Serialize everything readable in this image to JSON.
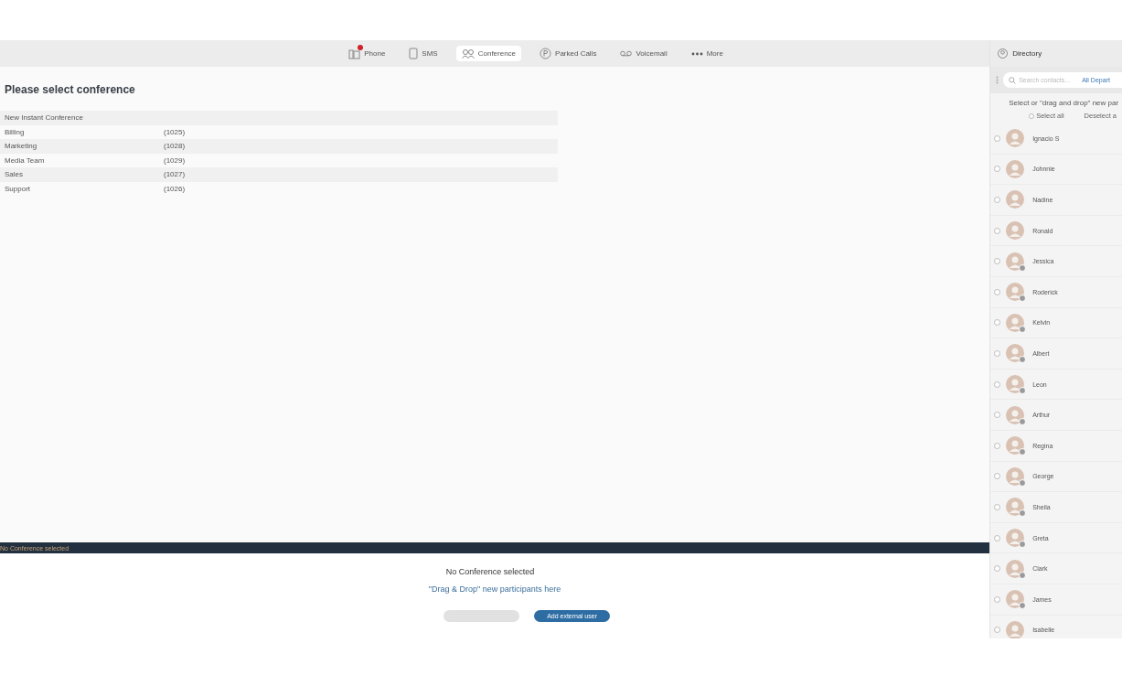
{
  "nav": {
    "tabs": [
      {
        "label": "Phone",
        "kind": "phone",
        "badge": true,
        "selected": false
      },
      {
        "label": "SMS",
        "kind": "sms",
        "badge": false,
        "selected": false
      },
      {
        "label": "Conference",
        "kind": "conference",
        "badge": false,
        "selected": true
      },
      {
        "label": "Parked Calls",
        "kind": "parked",
        "badge": false,
        "selected": false
      },
      {
        "label": "Voicemail",
        "kind": "voicemail",
        "badge": false,
        "selected": false
      },
      {
        "label": "More",
        "kind": "more",
        "badge": false,
        "selected": false
      }
    ]
  },
  "main": {
    "title": "Please select conference",
    "conferences": [
      {
        "name": "New Instant Conference"
      },
      {
        "name": "Billing",
        "number": "(1025)"
      },
      {
        "name": "Marketing",
        "number": "(1028)"
      },
      {
        "name": "Media Team",
        "number": "(1029)"
      },
      {
        "name": "Sales",
        "number": "(1027)"
      },
      {
        "name": "Support",
        "number": "(1026)"
      }
    ]
  },
  "status_bar": {
    "text": "No Conference selected"
  },
  "details": {
    "title": "No Conference selected",
    "hint": "\"Drag & Drop\" new participants here",
    "buttons": [
      {
        "disabled": true
      },
      {
        "label": "Add external user",
        "disabled": false
      }
    ]
  },
  "directory": {
    "title": "Directory",
    "search": {
      "placeholder": "Search contacts..."
    },
    "filter": "All Depart",
    "instruction": "Select or \"drag and drop\" new par",
    "select_all": "Select all",
    "deselect_all": "Deselect a",
    "contacts": [
      {
        "name": "Ignacio S",
        "selected": false,
        "presence": false
      },
      {
        "name": "Johnnie",
        "selected": false,
        "presence": false
      },
      {
        "name": "Nadine",
        "selected": false,
        "presence": false
      },
      {
        "name": "Ronald",
        "selected": false,
        "presence": false
      },
      {
        "name": "Jessica",
        "selected": false,
        "presence": true
      },
      {
        "name": "Roderick",
        "selected": false,
        "presence": true
      },
      {
        "name": "Kelvin",
        "selected": false,
        "presence": true
      },
      {
        "name": "Albert",
        "selected": false,
        "presence": true
      },
      {
        "name": "Leon",
        "selected": false,
        "presence": true
      },
      {
        "name": "Arthur",
        "selected": false,
        "presence": true
      },
      {
        "name": "Regina",
        "selected": false,
        "presence": true
      },
      {
        "name": "George",
        "selected": false,
        "presence": true
      },
      {
        "name": "Sheila",
        "selected": false,
        "presence": true
      },
      {
        "name": "Greta",
        "selected": false,
        "presence": true
      },
      {
        "name": "Clark",
        "selected": false,
        "presence": true
      },
      {
        "name": "James",
        "selected": false,
        "presence": true
      },
      {
        "name": "Isabelle",
        "selected": false,
        "presence": false
      }
    ]
  }
}
